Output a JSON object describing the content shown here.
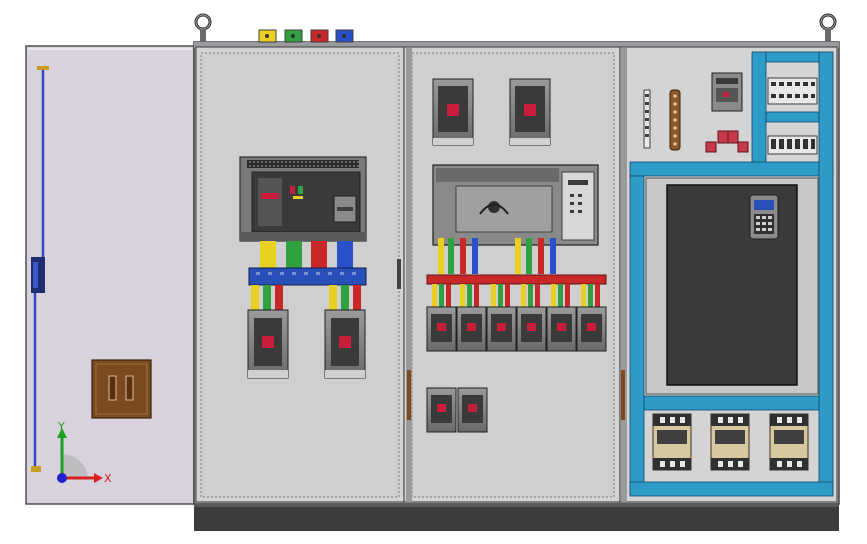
{
  "scene": {
    "colors": {
      "background": "#ffffff",
      "door": "#d8d2dc",
      "panel": "#d4d4d4",
      "panel_inner": "#c8c8c8",
      "frame_edge": "#505050",
      "base": "#3c3c3c",
      "din_rail_blue": "#2e9ac8",
      "busbar_blue": "#2850b8",
      "breaker_gray": "#8a8a8a",
      "breaker_dark": "#3a3a3a",
      "breaker_red": "#c81e3c",
      "phase_yellow": "#e8d020",
      "phase_green": "#30a040",
      "phase_red": "#c82828",
      "phase_blue": "#2850c8",
      "terminal_brown": "#8a5a2a",
      "lock_brown": "#7a4a20",
      "contactor_beige": "#d8c8a0",
      "axis_x": "#d82020",
      "axis_y": "#20a020",
      "axis_z": "#2020d0"
    },
    "axis_triad": {
      "x_label": "X",
      "y_label": "Y"
    },
    "icons": [
      "lifting-eye-icon",
      "axis-triad-icon",
      "door-lock-icon"
    ]
  }
}
